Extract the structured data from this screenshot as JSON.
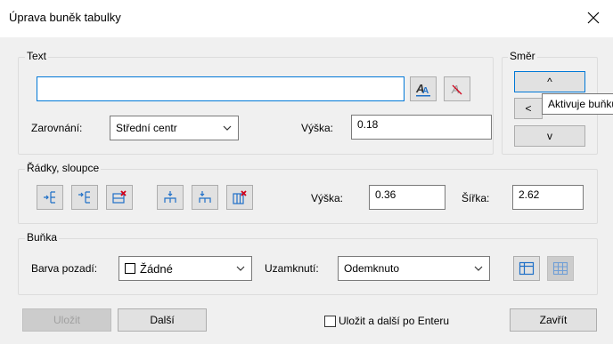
{
  "window": {
    "title": "Úprava buněk tabulky",
    "close_glyph": "✕"
  },
  "text_group": {
    "label": "Text",
    "text_value": "",
    "alignment_label": "Zarovnání:",
    "alignment_value": "Střední centr",
    "height_label": "Výška:",
    "height_value": "0.18"
  },
  "direction_group": {
    "label": "Směr",
    "up": "^",
    "left": "<",
    "down": "v",
    "tooltip": "Aktivuje buňku"
  },
  "rows_group": {
    "label": "Řádky, sloupce",
    "height_label": "Výška:",
    "height_value": "0.36",
    "width_label": "Šířka:",
    "width_value": "2.62"
  },
  "cell_group": {
    "label": "Buňka",
    "bg_label": "Barva pozadí:",
    "bg_value": "Žádné",
    "lock_label": "Uzamknutí:",
    "lock_value": "Odemknuto"
  },
  "footer": {
    "save": "Uložit",
    "next": "Další",
    "checkbox_label": "Uložit a další po Enteru",
    "close": "Zavřít"
  },
  "colors": {
    "accent": "#0078d7",
    "delete_red": "#d0021b",
    "icon_blue": "#1e6fc7"
  }
}
